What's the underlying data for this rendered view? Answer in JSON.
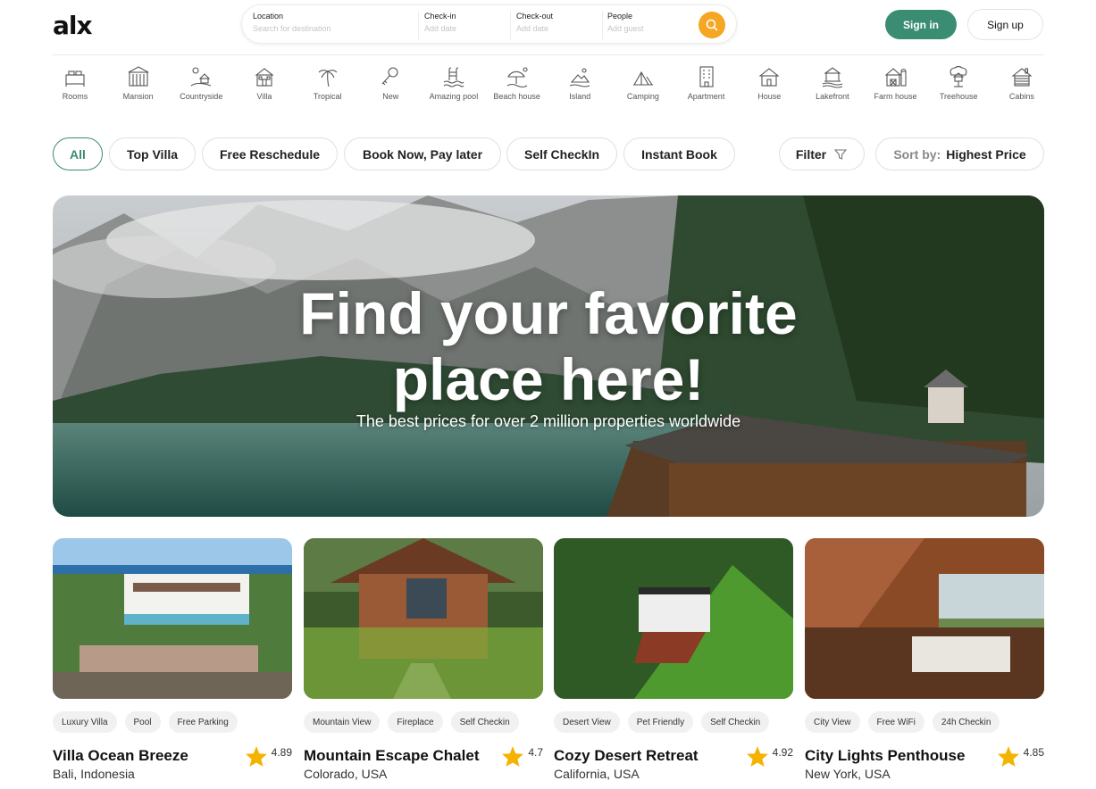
{
  "header": {
    "logo": "alx",
    "search": {
      "location": {
        "label": "Location",
        "placeholder": "Search for destination"
      },
      "checkin": {
        "label": "Check-in",
        "placeholder": "Add date"
      },
      "checkout": {
        "label": "Check-out",
        "placeholder": "Add date"
      },
      "people": {
        "label": "People",
        "placeholder": "Add guest"
      }
    },
    "signin_label": "Sign in",
    "signup_label": "Sign up"
  },
  "categories": [
    {
      "label": "Rooms",
      "icon": "rooms-icon"
    },
    {
      "label": "Mansion",
      "icon": "mansion-icon"
    },
    {
      "label": "Countryside",
      "icon": "countryside-icon"
    },
    {
      "label": "Villa",
      "icon": "villa-icon"
    },
    {
      "label": "Tropical",
      "icon": "palm-tree-icon"
    },
    {
      "label": "New",
      "icon": "key-icon"
    },
    {
      "label": "Amazing pool",
      "icon": "pool-icon"
    },
    {
      "label": "Beach house",
      "icon": "beach-house-icon"
    },
    {
      "label": "Island",
      "icon": "island-icon"
    },
    {
      "label": "Camping",
      "icon": "tent-icon"
    },
    {
      "label": "Apartment",
      "icon": "apartment-icon"
    },
    {
      "label": "House",
      "icon": "house-icon"
    },
    {
      "label": "Lakefront",
      "icon": "lakefront-icon"
    },
    {
      "label": "Farm house",
      "icon": "farm-house-icon"
    },
    {
      "label": "Treehouse",
      "icon": "treehouse-icon"
    },
    {
      "label": "Cabins",
      "icon": "cabin-icon"
    }
  ],
  "filters": {
    "pills": [
      "All",
      "Top Villa",
      "Free Reschedule",
      "Book Now, Pay later",
      "Self CheckIn",
      "Instant Book"
    ],
    "filter_label": "Filter",
    "sort_prefix": "Sort by:",
    "sort_value": "Highest Price"
  },
  "hero": {
    "title_line1": "Find your favorite",
    "title_line2": "place here!",
    "subtitle": "The best prices for over 2 million properties worldwide"
  },
  "listings": [
    {
      "title": "Villa Ocean Breeze",
      "location": "Bali, Indonesia",
      "rating": "4.89",
      "tags": [
        "Luxury Villa",
        "Pool",
        "Free Parking"
      ]
    },
    {
      "title": "Mountain Escape Chalet",
      "location": "Colorado, USA",
      "rating": "4.7",
      "tags": [
        "Mountain View",
        "Fireplace",
        "Self Checkin"
      ]
    },
    {
      "title": "Cozy Desert Retreat",
      "location": "California, USA",
      "rating": "4.92",
      "tags": [
        "Desert View",
        "Pet Friendly",
        "Self Checkin"
      ]
    },
    {
      "title": "City Lights Penthouse",
      "location": "New York, USA",
      "rating": "4.85",
      "tags": [
        "City View",
        "Free WiFi",
        "24h Checkin"
      ]
    }
  ],
  "colors": {
    "accent": "#3a8c73",
    "search_button": "#f5a623",
    "star": "#f5b301"
  }
}
